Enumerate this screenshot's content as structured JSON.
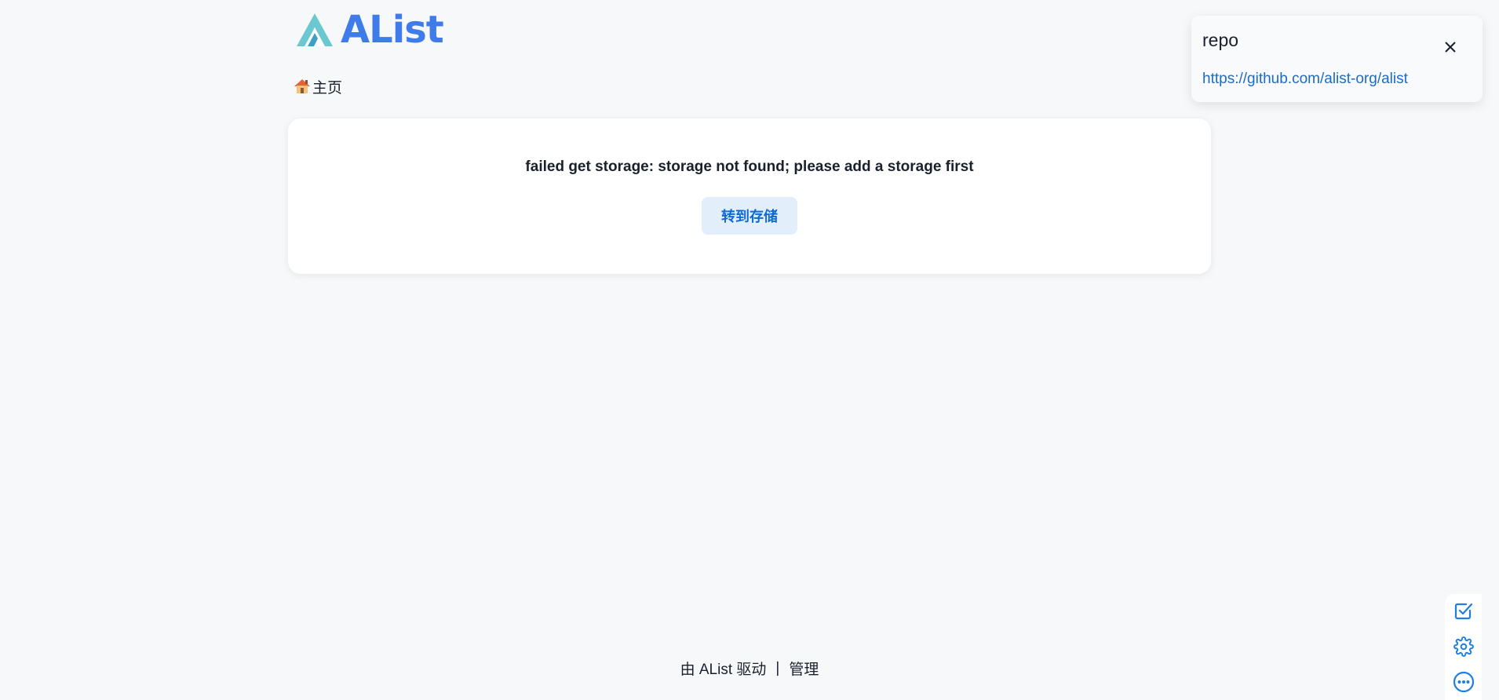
{
  "header": {
    "logo_text": "AList",
    "brand_color": "#3f7be9",
    "logo_mark_colors": [
      "#6cc8d0",
      "#3f9fc4"
    ]
  },
  "breadcrumb": {
    "home_icon": "house-emoji",
    "home_label": "主页"
  },
  "main": {
    "error_message": "failed get storage: storage not found; please add a storage first",
    "go_storage_label": "转到存储"
  },
  "toast": {
    "title": "repo",
    "link": "https://github.com/alist-org/alist",
    "close_icon": "close-icon"
  },
  "footer": {
    "powered_by": "由 AList 驱动",
    "separator": "|",
    "manage_label": "管理"
  },
  "side_tools": {
    "icons": [
      "checkbox-icon",
      "gear-icon",
      "more-icon"
    ],
    "color": "#1c7fe0"
  }
}
